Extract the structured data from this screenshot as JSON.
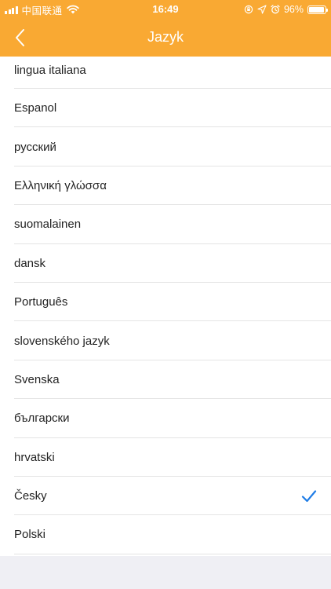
{
  "status_bar": {
    "carrier": "中国联通",
    "time": "16:49",
    "battery_percent": "96%",
    "battery_level": 0.96,
    "icons": [
      "signal-icon",
      "wifi-icon",
      "screen-lock-icon",
      "location-icon",
      "alarm-icon",
      "battery-icon"
    ]
  },
  "header": {
    "title": "Jazyk",
    "back_icon": "chevron-left-icon"
  },
  "colors": {
    "header_bg": "#f9a933",
    "check": "#1e7ce6",
    "text": "#222222",
    "footer_bg": "#efeff4"
  },
  "languages": [
    {
      "label": "lingua italiana",
      "selected": false
    },
    {
      "label": "Espanol",
      "selected": false
    },
    {
      "label": "русский",
      "selected": false
    },
    {
      "label": "Ελληνική γλώσσα",
      "selected": false
    },
    {
      "label": "suomalainen",
      "selected": false
    },
    {
      "label": "dansk",
      "selected": false
    },
    {
      "label": "Português",
      "selected": false
    },
    {
      "label": "slovenského jazyk",
      "selected": false
    },
    {
      "label": "Svenska",
      "selected": false
    },
    {
      "label": "български",
      "selected": false
    },
    {
      "label": "hrvatski",
      "selected": false
    },
    {
      "label": "Česky",
      "selected": true
    },
    {
      "label": "Polski",
      "selected": false
    }
  ]
}
